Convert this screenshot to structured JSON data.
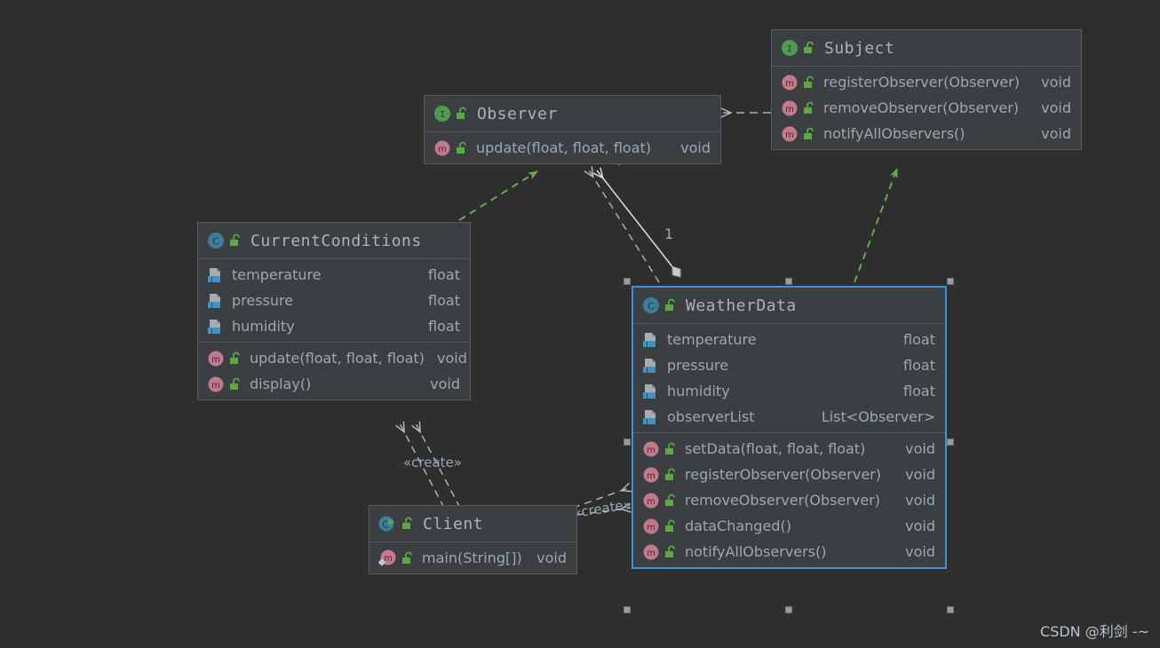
{
  "canvas": {
    "background": "#2e2e2e",
    "node_bg": "#3c3f41",
    "node_border": "#555a5c",
    "selection_color": "#3f8fd9",
    "text_color": "#9aa7b4",
    "realize_color": "#6aa84f",
    "dependency_color": "#b0b0b0"
  },
  "nodes": {
    "subject": {
      "title": "Subject",
      "kind_icon": "interface-icon",
      "visibility_icon": "public-lock-icon",
      "fields": [],
      "methods": [
        {
          "icon": "method-icon",
          "lock": "public-lock-icon",
          "label": "registerObserver(Observer)",
          "type": "void"
        },
        {
          "icon": "method-icon",
          "lock": "public-lock-icon",
          "label": "removeObserver(Observer)",
          "type": "void"
        },
        {
          "icon": "method-icon",
          "lock": "public-lock-icon",
          "label": "notifyAllObservers()",
          "type": "void"
        }
      ]
    },
    "observer": {
      "title": "Observer",
      "kind_icon": "interface-icon",
      "visibility_icon": "public-lock-icon",
      "fields": [],
      "methods": [
        {
          "icon": "method-icon",
          "lock": "public-lock-icon",
          "label": "update(float, float, float)",
          "type": "void"
        }
      ]
    },
    "current_conditions": {
      "title": "CurrentConditions",
      "kind_icon": "class-icon",
      "visibility_icon": "public-lock-icon",
      "fields": [
        {
          "icon": "field-icon",
          "label": "temperature",
          "type": "float"
        },
        {
          "icon": "field-icon",
          "label": "pressure",
          "type": "float"
        },
        {
          "icon": "field-icon",
          "label": "humidity",
          "type": "float"
        }
      ],
      "methods": [
        {
          "icon": "method-icon",
          "lock": "public-lock-icon",
          "label": "update(float, float, float)",
          "type": "void"
        },
        {
          "icon": "method-icon",
          "lock": "public-lock-icon",
          "label": "display()",
          "type": "void"
        }
      ]
    },
    "weather_data": {
      "title": "WeatherData",
      "kind_icon": "class-icon",
      "visibility_icon": "public-lock-icon",
      "selected": true,
      "fields": [
        {
          "icon": "field-icon",
          "label": "temperature",
          "type": "float"
        },
        {
          "icon": "field-icon",
          "label": "pressure",
          "type": "float"
        },
        {
          "icon": "field-icon",
          "label": "humidity",
          "type": "float"
        },
        {
          "icon": "field-icon",
          "label": "observerList",
          "type": "List<Observer>"
        }
      ],
      "methods": [
        {
          "icon": "method-icon",
          "lock": "public-lock-icon",
          "label": "setData(float, float, float)",
          "type": "void"
        },
        {
          "icon": "method-icon",
          "lock": "public-lock-icon",
          "label": "registerObserver(Observer)",
          "type": "void"
        },
        {
          "icon": "method-icon",
          "lock": "public-lock-icon",
          "label": "removeObserver(Observer)",
          "type": "void"
        },
        {
          "icon": "method-icon",
          "lock": "public-lock-icon",
          "label": "dataChanged()",
          "type": "void"
        },
        {
          "icon": "method-icon",
          "lock": "public-lock-icon",
          "label": "notifyAllObservers()",
          "type": "void"
        }
      ]
    },
    "client": {
      "title": "Client",
      "kind_icon": "runnable-class-icon",
      "visibility_icon": "public-lock-icon",
      "fields": [],
      "methods": [
        {
          "icon": "main-method-icon",
          "lock": "public-lock-icon",
          "label": "main(String[])",
          "type": "void"
        }
      ]
    }
  },
  "edges": {
    "subject_to_observer": {
      "kind": "dependency",
      "label": ""
    },
    "weatherdata_to_subject": {
      "kind": "realization",
      "label": ""
    },
    "currentconditions_to_observer": {
      "kind": "realization",
      "label": ""
    },
    "weatherdata_to_observer_assoc": {
      "kind": "aggregation",
      "source_mult": "1",
      "target_mult": "*"
    },
    "weatherdata_dep_observer": {
      "kind": "dependency",
      "label": ""
    },
    "client_to_currentconditions_1": {
      "kind": "create-dependency",
      "label": "«create»"
    },
    "client_to_currentconditions_2": {
      "kind": "create-dependency",
      "label": ""
    },
    "client_to_weatherdata": {
      "kind": "create-dependency",
      "label": "«create»"
    }
  },
  "watermark": {
    "text": "CSDN @利剑 -~"
  }
}
